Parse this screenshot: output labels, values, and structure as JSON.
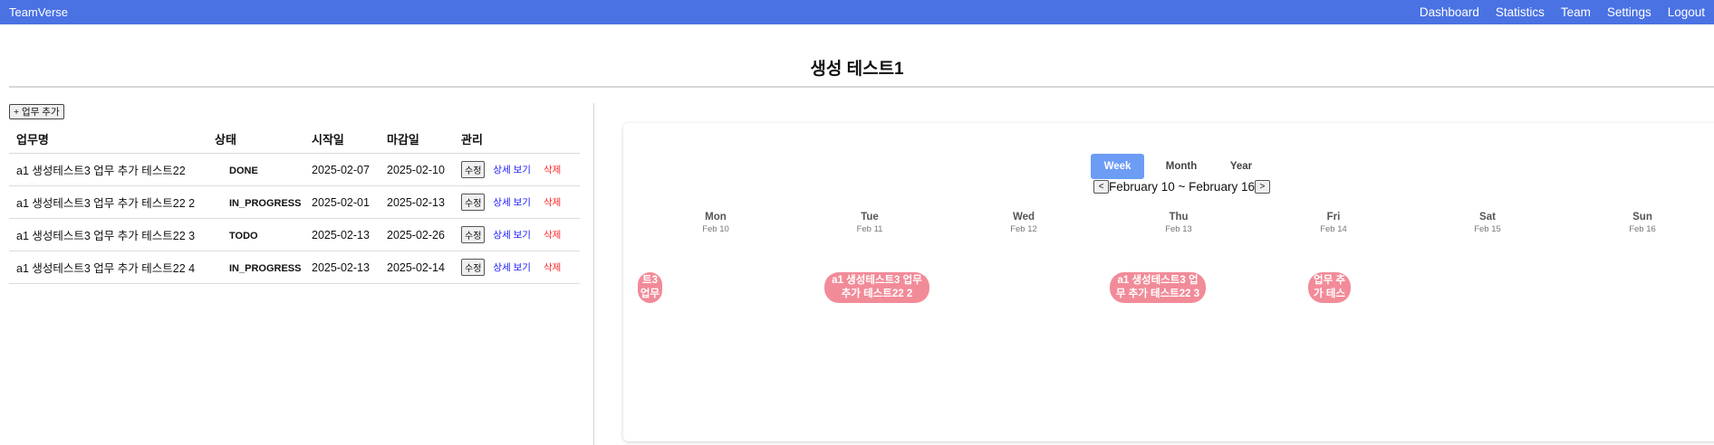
{
  "app": {
    "brand": "TeamVerse"
  },
  "nav": [
    "Dashboard",
    "Statistics",
    "Team",
    "Settings",
    "Logout"
  ],
  "page": {
    "title": "생성 테스트1"
  },
  "toolbar": {
    "add_task_label": "+ 업무 추가"
  },
  "table": {
    "headers": {
      "name": "업무명",
      "status": "상태",
      "start": "시작일",
      "due": "마감일",
      "manage": "관리"
    },
    "actions": {
      "edit": "수정",
      "detail": "상세 보기",
      "delete": "삭제"
    },
    "rows": [
      {
        "name": "a1 생성테스트3 업무 추가 테스트22",
        "status": "DONE",
        "start": "2025-02-07",
        "due": "2025-02-10"
      },
      {
        "name": "a1 생성테스트3 업무 추가 테스트22 2",
        "status": "IN_PROGRESS",
        "start": "2025-02-01",
        "due": "2025-02-13"
      },
      {
        "name": "a1 생성테스트3 업무 추가 테스트22 3",
        "status": "TODO",
        "start": "2025-02-13",
        "due": "2025-02-26"
      },
      {
        "name": "a1 생성테스트3 업무 추가 테스트22 4",
        "status": "IN_PROGRESS",
        "start": "2025-02-13",
        "due": "2025-02-14"
      }
    ]
  },
  "calendar": {
    "views": [
      "Week",
      "Month",
      "Year"
    ],
    "active_view": "Week",
    "range_label": "February 10 ~ February 16",
    "prev_label": "<",
    "next_label": ">",
    "days": [
      {
        "name": "Mon",
        "date": "Feb 10"
      },
      {
        "name": "Tue",
        "date": "Feb 11"
      },
      {
        "name": "Wed",
        "date": "Feb 12"
      },
      {
        "name": "Thu",
        "date": "Feb 13"
      },
      {
        "name": "Fri",
        "date": "Feb 14"
      },
      {
        "name": "Sat",
        "date": "Feb 15"
      },
      {
        "name": "Sun",
        "date": "Feb 16"
      }
    ],
    "events": [
      {
        "line1": "트3",
        "line2": "업무"
      },
      {
        "line1": "a1 생성테스트3 업무",
        "line2": "추가 테스트22 2"
      },
      {
        "line1": "a1 생성테스트3 업",
        "line2": "무 추가 테스트22 3"
      },
      {
        "line1": "업무 추",
        "line2": "가 테스"
      }
    ],
    "event_color": "#f28b98"
  },
  "colors": {
    "nav_bar": "#4a72e3",
    "active_view": "#6d9cf5",
    "detail_link": "#1a1aff",
    "delete_link": "#ff2a2a"
  }
}
